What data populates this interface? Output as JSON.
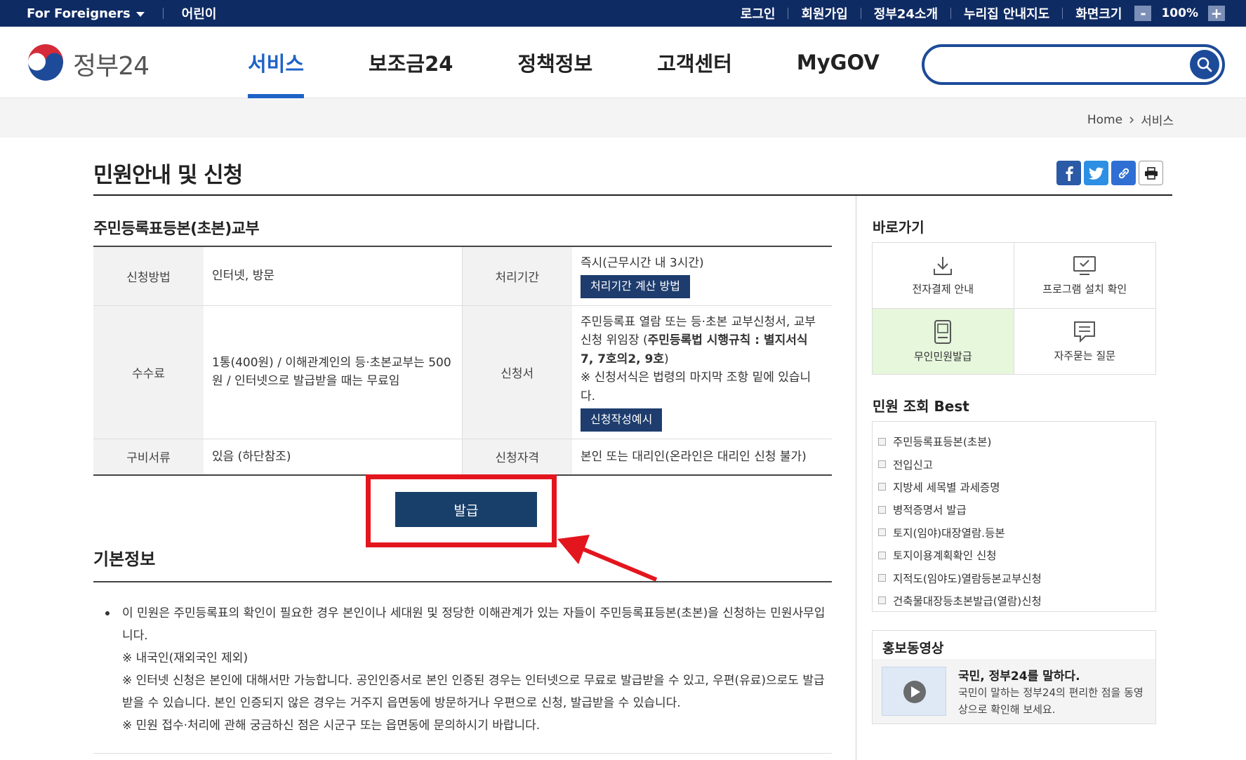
{
  "utilbar": {
    "foreigners": "For Foreigners",
    "kids": "어린이",
    "login": "로그인",
    "signup": "회원가입",
    "about": "정부24소개",
    "map": "누리집 안내지도",
    "screen_size": "화면크기",
    "zoom_minus": "-",
    "zoom_value": "100%",
    "zoom_plus": "+"
  },
  "header": {
    "logo_text": "정부24",
    "nav": [
      "서비스",
      "보조금24",
      "정책정보",
      "고객센터",
      "MyGOV"
    ],
    "nav_active": "서비스",
    "search_placeholder": "",
    "search_value": ""
  },
  "breadcrumb": {
    "home": "Home",
    "current": "서비스"
  },
  "page": {
    "title": "민원안내 및 신청",
    "subtitle": "주민등록표등본(초본)교부"
  },
  "info_table": {
    "row1": {
      "label_a": "신청방법",
      "value_a": "인터넷, 방문",
      "label_b": "처리기간",
      "value_b": "즉시(근무시간 내 3시간)",
      "btn_b": "처리기간 계산 방법"
    },
    "row2": {
      "label_a": "수수료",
      "value_a": "1통(400원) / 이해관계인의 등·초본교부는 500원 / 인터넷으로 발급받을 때는 무료임",
      "label_b": "신청서",
      "value_b_1": "주민등록표 열람 또는 등·초본 교부신청서, 교부신청 위임장 (",
      "value_b_bold": "주민등록법 시행규칙 : 별지서식 7, 7호의2, 9호",
      "value_b_2": ")",
      "value_b_note": "※ 신청서식은 법령의 마지막 조항 밑에 있습니다.",
      "btn_b": "신청작성예시"
    },
    "row3": {
      "label_a": "구비서류",
      "value_a": "있음 (하단참조)",
      "label_b": "신청자격",
      "value_b": "본인 또는 대리인(온라인은 대리인 신청 불가)"
    }
  },
  "issue_button": "발급",
  "basic_info": {
    "heading": "기본정보",
    "lines": [
      "이 민원은 주민등록표의 확인이 필요한 경우 본인이나 세대원 및 정당한 이해관계가 있는 자들이 주민등록표등본(초본)을 신청하는 민원사무입니다.",
      "※ 내국인(재외국인 제외)",
      "※ 인터넷 신청은 본인에 대해서만 가능합니다. 공인인증서로 본인 인증된 경우는 인터넷으로 무료로 발급받을 수 있고, 우편(유료)으로도 발급받을 수 있습니다. 본인 인증되지 않은 경우는 거주지 읍면동에 방문하거나 우편으로 신청, 발급받을 수 있습니다.",
      "※ 민원 접수·처리에 관해 궁금하신 점은 시군구 또는 읍면동에 문의하시기 바랍니다."
    ]
  },
  "sidebar": {
    "quick_title": "바로가기",
    "quick_items": [
      {
        "label": "전자결제 안내",
        "icon": "download-icon"
      },
      {
        "label": "프로그램 설치 확인",
        "icon": "monitor-check-icon"
      },
      {
        "label": "무인민원발급",
        "icon": "kiosk-icon"
      },
      {
        "label": "자주묻는 질문",
        "icon": "chat-icon"
      }
    ],
    "best_title": "민원 조회 Best",
    "best_items": [
      "주민등록표등본(초본)",
      "전입신고",
      "지방세 세목별 과세증명",
      "병적증명서 발급",
      "토지(임야)대장열람.등본",
      "토지이용계획확인 신청",
      "지적도(임야도)열람등본교부신청",
      "건축물대장등초본발급(열람)신청"
    ],
    "promo_title": "홍보동영상",
    "promo_video_title": "국민, 정부24를 말하다.",
    "promo_video_desc": "국민이 말하는 정부24의 편리한 점을 동영상으로 확인해 보세요."
  },
  "colors": {
    "utilbar": "#0f2b63",
    "nav_active": "#1d63c7",
    "button_navy": "#1e3d6e",
    "highlight_red": "#e3161e",
    "quick_active_bg": "#e6f7dc"
  }
}
